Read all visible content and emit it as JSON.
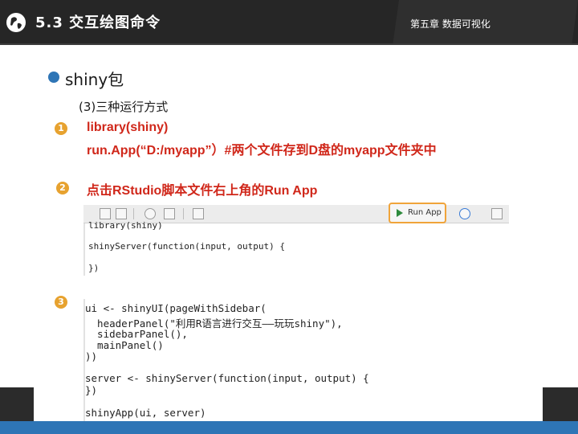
{
  "header": {
    "section_title": "5.3  交互绘图命令",
    "chapter": "第五章 数据可视化",
    "logo_icon": "globe-icon"
  },
  "slide": {
    "bullet": "shiny包",
    "subheading": "(3)三种运行方式"
  },
  "methods": {
    "one": {
      "badge": "1",
      "line1": "library(shiny)",
      "line2": "run.App(“D:/myapp”）#两个文件存到D盘的myapp文件夹中"
    },
    "two": {
      "badge": "2",
      "text": "点击RStudio脚本文件右上角的Run App",
      "run_button_label": "Run App",
      "code": [
        "library(shiny)",
        "shinyServer(function(input, output) {",
        "})"
      ]
    },
    "three": {
      "badge": "3",
      "code": [
        "ui <- shinyUI(pageWithSidebar(",
        "  headerPanel(\"利用R语言进行交互——玩玩shiny\"),",
        "  sidebarPanel(),",
        "  mainPanel()",
        "))",
        "server <- shinyServer(function(input, output) {",
        "})",
        "shinyApp(ui, server)"
      ]
    }
  },
  "colors": {
    "header_bg": "#262626",
    "accent_blue": "#2e75b6",
    "badge_orange": "#e7a22f",
    "highlight_red": "#d0271a",
    "run_outline": "#f0a43a"
  }
}
